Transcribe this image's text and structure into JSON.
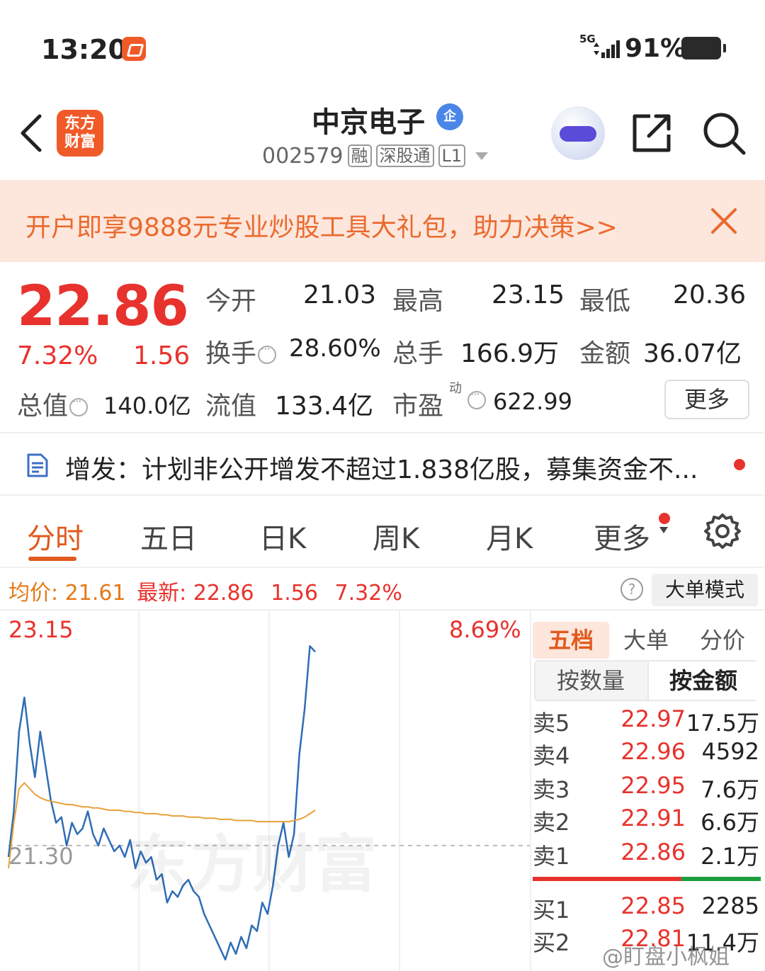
{
  "status_bar": {
    "time": "13:20",
    "network": "5G",
    "battery": "91%",
    "battery_level": 0.91
  },
  "header": {
    "app_logo_line1": "东方",
    "app_logo_line2": "财富",
    "stock_name": "中京电子",
    "ent_badge": "企",
    "stock_code": "002579",
    "tags": [
      "融",
      "深股通",
      "L1"
    ]
  },
  "promo": {
    "text": "开户即享9888元专业炒股工具大礼包，助力决策>>"
  },
  "quote": {
    "price": "22.86",
    "change_pct": "7.32%",
    "change_abs": "1.56",
    "fields": {
      "open_label": "今开",
      "open": "21.03",
      "high_label": "最高",
      "high": "23.15",
      "low_label": "最低",
      "low": "20.36",
      "turnover_label": "换手",
      "turnover": "28.60%",
      "volume_label": "总手",
      "volume": "166.9万",
      "amount_label": "金额",
      "amount": "36.07亿",
      "mktcap_label": "总值",
      "mktcap": "140.0亿",
      "float_label": "流值",
      "float": "133.4亿",
      "pe_label": "市盈",
      "pe_sup": "动",
      "pe": "622.99"
    },
    "more_label": "更多"
  },
  "news": {
    "text": "增发：计划非公开增发不超过1.838亿股，募集资金不..."
  },
  "tabs": [
    "分时",
    "五日",
    "日K",
    "周K",
    "月K",
    "更多"
  ],
  "avg_row": {
    "avg_label": "均价:",
    "avg": "21.61",
    "latest_label": "最新:",
    "latest": "22.86",
    "chg": "1.56",
    "pct": "7.32%",
    "help": "?",
    "big_order_mode": "大单模式"
  },
  "chart_data": {
    "type": "line",
    "y_top_label": "23.15",
    "y_top_pct": "8.69%",
    "y_mid_label": "21.30",
    "ylim": [
      20.2,
      23.3
    ],
    "prev_close": 21.3,
    "watermark": "东方财富",
    "series": [
      {
        "color": "#2f6db5",
        "values": [
          21.2,
          21.6,
          22.3,
          22.6,
          22.2,
          21.9,
          22.3,
          22.0,
          21.7,
          21.5,
          21.55,
          21.3,
          21.5,
          21.4,
          21.45,
          21.6,
          21.4,
          21.3,
          21.45,
          21.35,
          21.25,
          21.3,
          21.2,
          21.35,
          21.1,
          21.25,
          21.15,
          21.2,
          21.0,
          21.05,
          20.8,
          20.9,
          20.85,
          20.95,
          21.0,
          20.9,
          20.85,
          20.7,
          20.6,
          20.5,
          20.4,
          20.3,
          20.45,
          20.35,
          20.5,
          20.4,
          20.6,
          20.55,
          20.8,
          20.7,
          20.95,
          21.3,
          21.5,
          21.2,
          21.4,
          22.1,
          22.5,
          23.05,
          23.0
        ]
      },
      {
        "color": "#e8a13a",
        "values": [
          21.1,
          21.5,
          21.8,
          21.85,
          21.8,
          21.75,
          21.72,
          21.7,
          21.69,
          21.68,
          21.67,
          21.66,
          21.66,
          21.65,
          21.64,
          21.64,
          21.63,
          21.63,
          21.62,
          21.61,
          21.61,
          21.61,
          21.6,
          21.6,
          21.59,
          21.59,
          21.58,
          21.58,
          21.58,
          21.57,
          21.57,
          21.56,
          21.56,
          21.56,
          21.55,
          21.55,
          21.55,
          21.54,
          21.54,
          21.54,
          21.53,
          21.53,
          21.53,
          21.52,
          21.52,
          21.52,
          21.52,
          21.51,
          21.51,
          21.51,
          21.51,
          21.51,
          21.51,
          21.51,
          21.52,
          21.53,
          21.55,
          21.58,
          21.61
        ]
      }
    ]
  },
  "order_book": {
    "tabs": [
      "五档",
      "大单",
      "分价"
    ],
    "modes": [
      "按数量",
      "按金额"
    ],
    "asks": [
      {
        "label": "卖5",
        "price": "22.97",
        "vol": "17.5万"
      },
      {
        "label": "卖4",
        "price": "22.96",
        "vol": "4592"
      },
      {
        "label": "卖3",
        "price": "22.95",
        "vol": "7.6万"
      },
      {
        "label": "卖2",
        "price": "22.91",
        "vol": "6.6万"
      },
      {
        "label": "卖1",
        "price": "22.86",
        "vol": "2.1万"
      }
    ],
    "bids": [
      {
        "label": "买1",
        "price": "22.85",
        "vol": "2285"
      },
      {
        "label": "买2",
        "price": "22.81",
        "vol": "11.4万"
      }
    ],
    "watermark": "@盯盘小枫姐"
  }
}
